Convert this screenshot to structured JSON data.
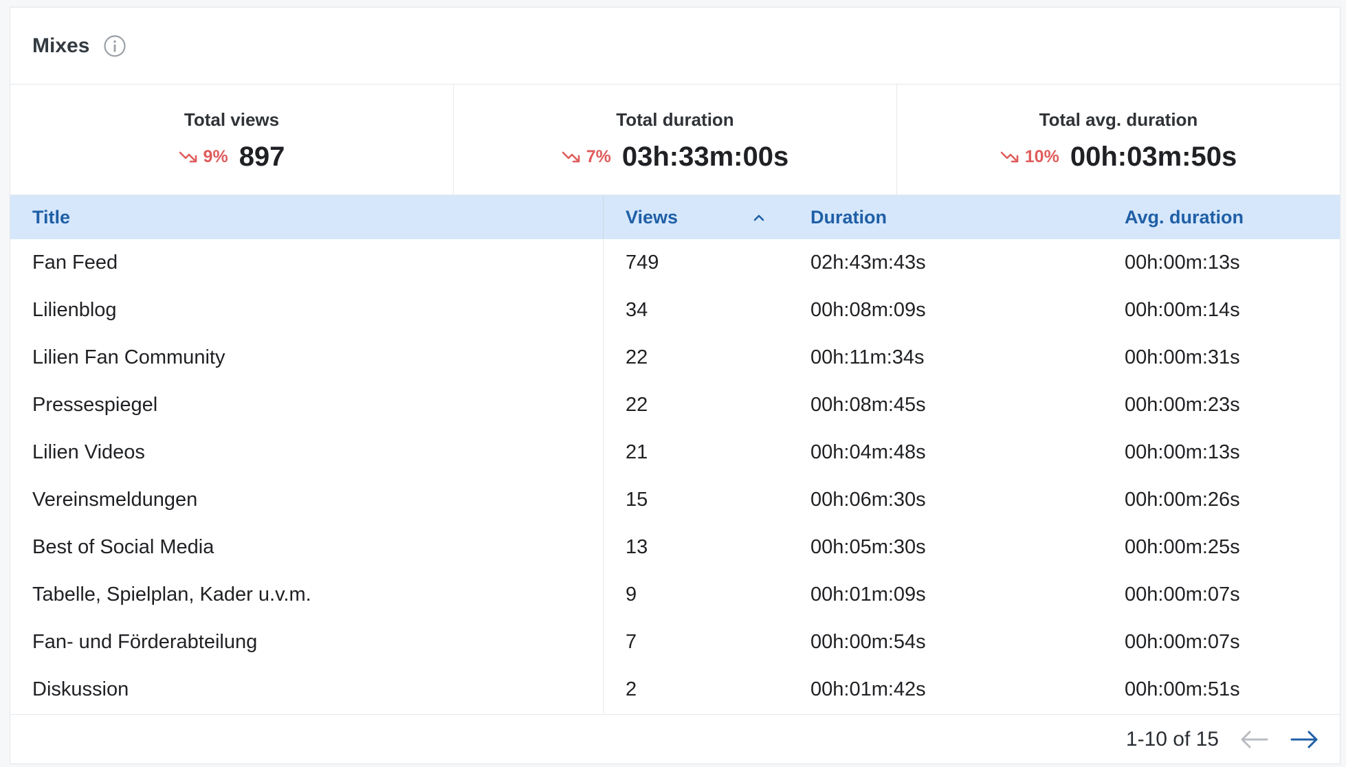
{
  "header": {
    "title": "Mixes",
    "info_icon": "info-icon"
  },
  "stats": [
    {
      "label": "Total views",
      "trend": "9%",
      "trend_direction": "down",
      "value": "897"
    },
    {
      "label": "Total duration",
      "trend": "7%",
      "trend_direction": "down",
      "value": "03h:33m:00s"
    },
    {
      "label": "Total avg. duration",
      "trend": "10%",
      "trend_direction": "down",
      "value": "00h:03m:50s"
    }
  ],
  "table": {
    "columns": [
      "Title",
      "Views",
      "Duration",
      "Avg. duration"
    ],
    "sorted_column": "Views",
    "sort_icon": "chevron-up-icon",
    "rows": [
      [
        "Fan Feed",
        "749",
        "02h:43m:43s",
        "00h:00m:13s"
      ],
      [
        "Lilienblog",
        "34",
        "00h:08m:09s",
        "00h:00m:14s"
      ],
      [
        "Lilien Fan Community",
        "22",
        "00h:11m:34s",
        "00h:00m:31s"
      ],
      [
        "Pressespiegel",
        "22",
        "00h:08m:45s",
        "00h:00m:23s"
      ],
      [
        "Lilien Videos",
        "21",
        "00h:04m:48s",
        "00h:00m:13s"
      ],
      [
        "Vereinsmeldungen",
        "15",
        "00h:06m:30s",
        "00h:00m:26s"
      ],
      [
        "Best of Social Media",
        "13",
        "00h:05m:30s",
        "00h:00m:25s"
      ],
      [
        "Tabelle, Spielplan, Kader u.v.m.",
        "9",
        "00h:01m:09s",
        "00h:00m:07s"
      ],
      [
        "Fan- und Förderabteilung",
        "7",
        "00h:00m:54s",
        "00h:00m:07s"
      ],
      [
        "Diskussion",
        "2",
        "00h:01m:42s",
        "00h:00m:51s"
      ]
    ]
  },
  "pagination": {
    "range_text": "1-10 of 15",
    "prev_icon": "arrow-left-icon",
    "next_icon": "arrow-right-icon"
  },
  "colors": {
    "header_bg": "#d6e7fb",
    "header_text": "#1f5fa6",
    "trend_down": "#e05c5c",
    "next_arrow": "#1f5fa6",
    "prev_arrow_disabled": "#b8bcc2"
  }
}
